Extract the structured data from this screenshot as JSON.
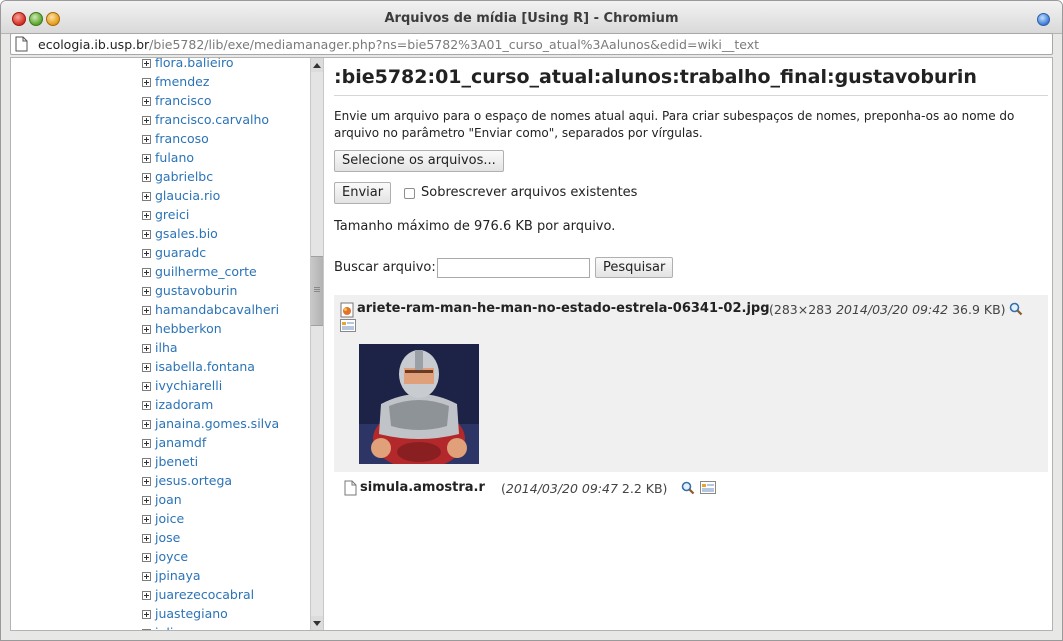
{
  "window": {
    "title": "Arquivos de mídia [Using R] - Chromium",
    "url_host": "ecologia.ib.usp.br",
    "url_path": "/bie5782/lib/exe/mediamanager.php?ns=bie5782%3A01_curso_atual%3Aalunos&edid=wiki__text"
  },
  "namespaces": [
    "flora.balieiro",
    "fmendez",
    "francisco",
    "francisco.carvalho",
    "francoso",
    "fulano",
    "gabrielbc",
    "glaucia.rio",
    "greici",
    "gsales.bio",
    "guaradc",
    "guilherme_corte",
    "gustavoburin",
    "hamandabcavalheri",
    "hebberkon",
    "ilha",
    "isabella.fontana",
    "ivychiarelli",
    "izadoram",
    "janaina.gomes.silva",
    "janamdf",
    "jbeneti",
    "jesus.ortega",
    "joan",
    "joice",
    "jose",
    "joyce",
    "jpinaya",
    "juarezecocabral",
    "juastegiano",
    "juliana"
  ],
  "main": {
    "title": ":bie5782:01_curso_atual:alunos:trabalho_final:gustavoburin",
    "description": "Envie um arquivo para o espaço de nomes atual aqui. Para criar subespaços de nomes, preponha-os ao nome do arquivo no parâmetro \"Enviar como\", separados por vírgulas.",
    "select_files": "Selecione os arquivos...",
    "send": "Enviar",
    "overwrite": "Sobrescrever arquivos existentes",
    "max_size": "Tamanho máximo de 976.6 KB por arquivo.",
    "search_label": "Buscar arquivo:",
    "search_value": "",
    "search_button": "Pesquisar"
  },
  "files": [
    {
      "name": "ariete-ram-man-he-man-no-estado-estrela-06341-02.jpg",
      "dims": "(283×283",
      "date": "2014/03/20 09:42",
      "size": "36.9 KB)"
    },
    {
      "name": "simula.amostra.r",
      "dims": "(",
      "date": "2014/03/20 09:47",
      "size": "2.2 KB)"
    }
  ],
  "colors": {
    "link": "#2b73b7",
    "file_row_bg": "#f0f0f0"
  },
  "icons": [
    "globe-icon",
    "page-icon",
    "image-file-icon",
    "magnifier-icon",
    "edit-icon",
    "text-file-icon"
  ]
}
